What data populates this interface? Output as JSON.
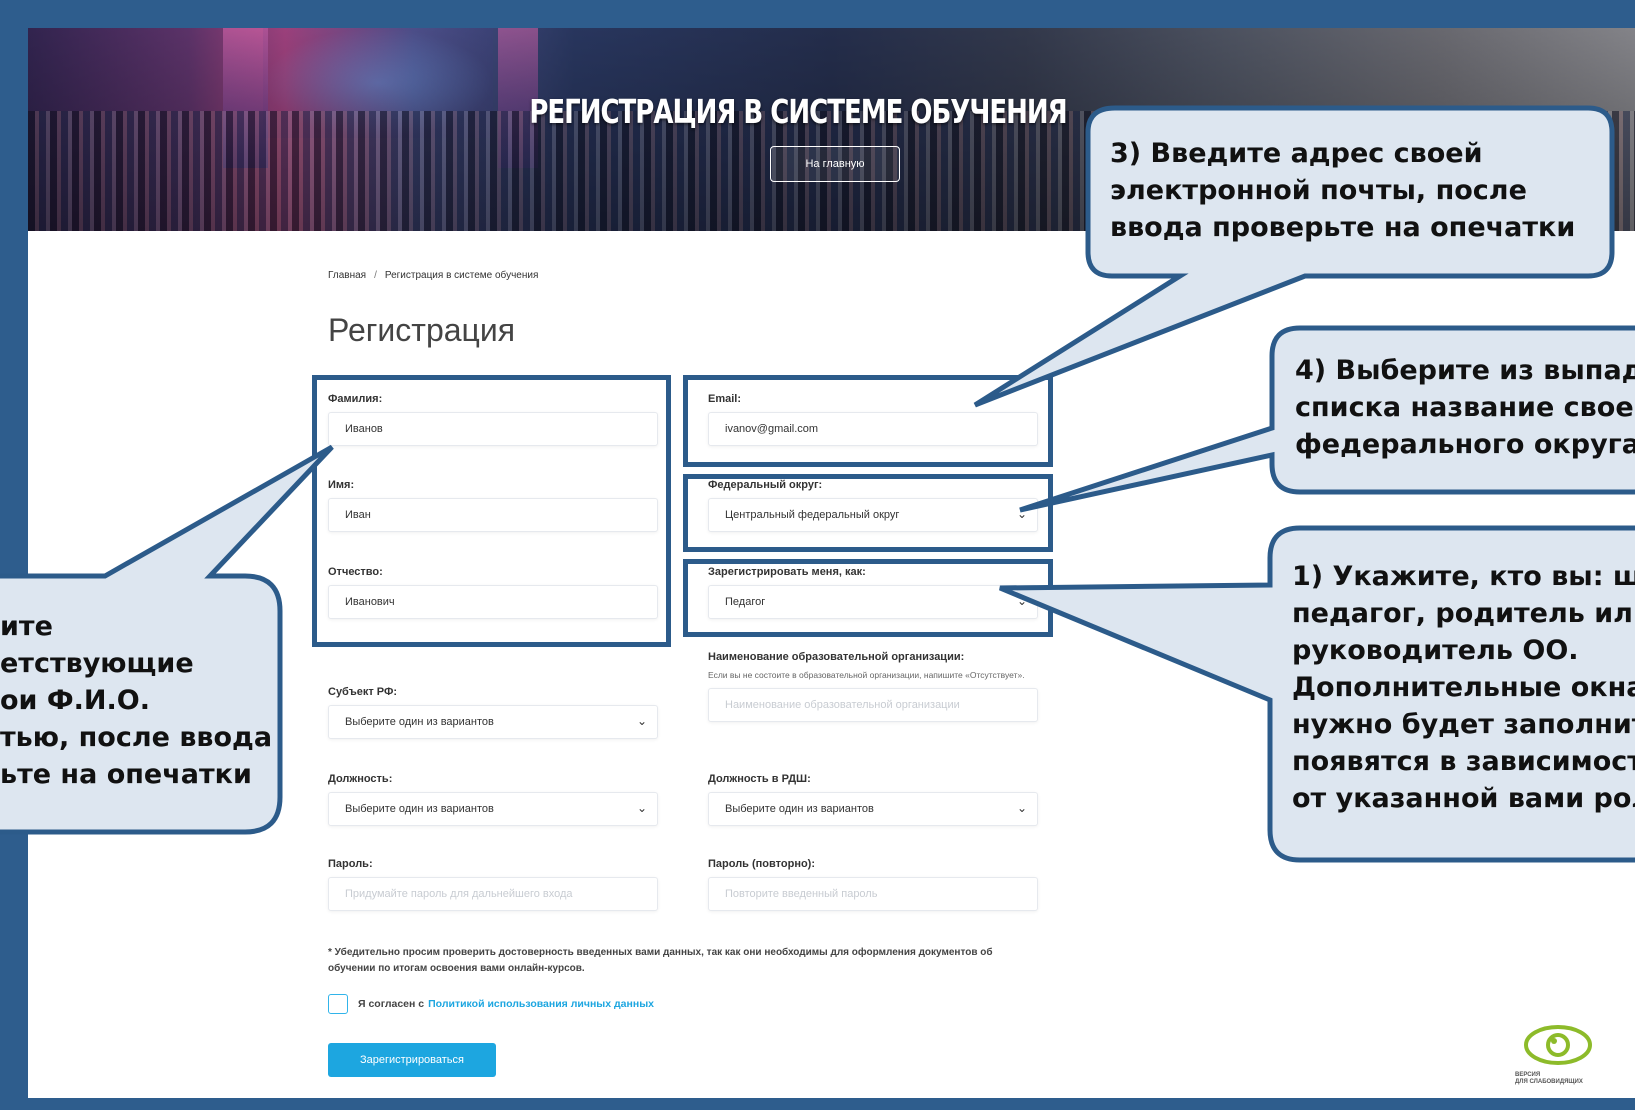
{
  "hero": {
    "title": "РЕГИСТРАЦИЯ В СИСТЕМЕ ОБУЧЕНИЯ",
    "home_button": "На главную"
  },
  "breadcrumb": {
    "home": "Главная",
    "separator": "/",
    "current": "Регистрация в системе обучения"
  },
  "page_title": "Регистрация",
  "form": {
    "surname": {
      "label": "Фамилия:",
      "value": "Иванов"
    },
    "name": {
      "label": "Имя:",
      "value": "Иван"
    },
    "patronymic": {
      "label": "Отчество:",
      "value": "Иванович"
    },
    "email": {
      "label": "Email:",
      "value": "ivanov@gmail.com"
    },
    "district": {
      "label": "Федеральный округ:",
      "value": "Центральный федеральный округ"
    },
    "role": {
      "label": "Зарегистрировать меня, как:",
      "value": "Педагог"
    },
    "region": {
      "label": "Субъект РФ:",
      "value": "Выберите один из вариантов"
    },
    "organization": {
      "label": "Наименование образовательной организации:",
      "hint": "Если вы не состоите в образовательной организации, напишите «Отсутствует».",
      "placeholder": "Наименование образовательной организации"
    },
    "position": {
      "label": "Должность:",
      "value": "Выберите один из вариантов"
    },
    "rdsh_position": {
      "label": "Должность в РДШ:",
      "value": "Выберите один из вариантов"
    },
    "password": {
      "label": "Пароль:",
      "placeholder": "Придумайте пароль для дальнейшего входа"
    },
    "password_repeat": {
      "label": "Пароль (повторно):",
      "placeholder": "Повторите введенный пароль"
    },
    "notice": "* Убедительно просим проверить достоверность введенных вами данных, так как они необходимы для оформления документов об обучении по итогам освоения вами онлайн-курсов.",
    "consent_text": "Я согласен с",
    "consent_link": "Политикой использования личных данных",
    "submit": "Зарегистрироваться"
  },
  "vision": {
    "line1": "ВЕРСИЯ",
    "line2": "ДЛЯ СЛАБОВИДЯЩИХ",
    "icon": "eye-icon"
  },
  "callouts": {
    "c3": [
      "3) Введите адрес своей",
      "электронной почты, после",
      "ввода проверьте на опечатки"
    ],
    "c4": [
      "4) Выберите из выпад",
      "списка название свое",
      "федерального округа"
    ],
    "c1": [
      "1) Укажите, кто вы: ш",
      "педагог, родитель или",
      "руководитель ОО.",
      "Дополнительные окна",
      "нужно будет заполнит",
      "появятся в зависимост",
      "от указанной вами рол"
    ],
    "c2": [
      "ите",
      "етствующие",
      "ои Ф.И.О.",
      "тью, после ввода",
      "ьте на опечатки"
    ]
  },
  "colors": {
    "frame": "#2e5d8d",
    "callout_fill": "#dde6f0",
    "callout_stroke": "#2c5b8a",
    "accent": "#1da6e0"
  }
}
